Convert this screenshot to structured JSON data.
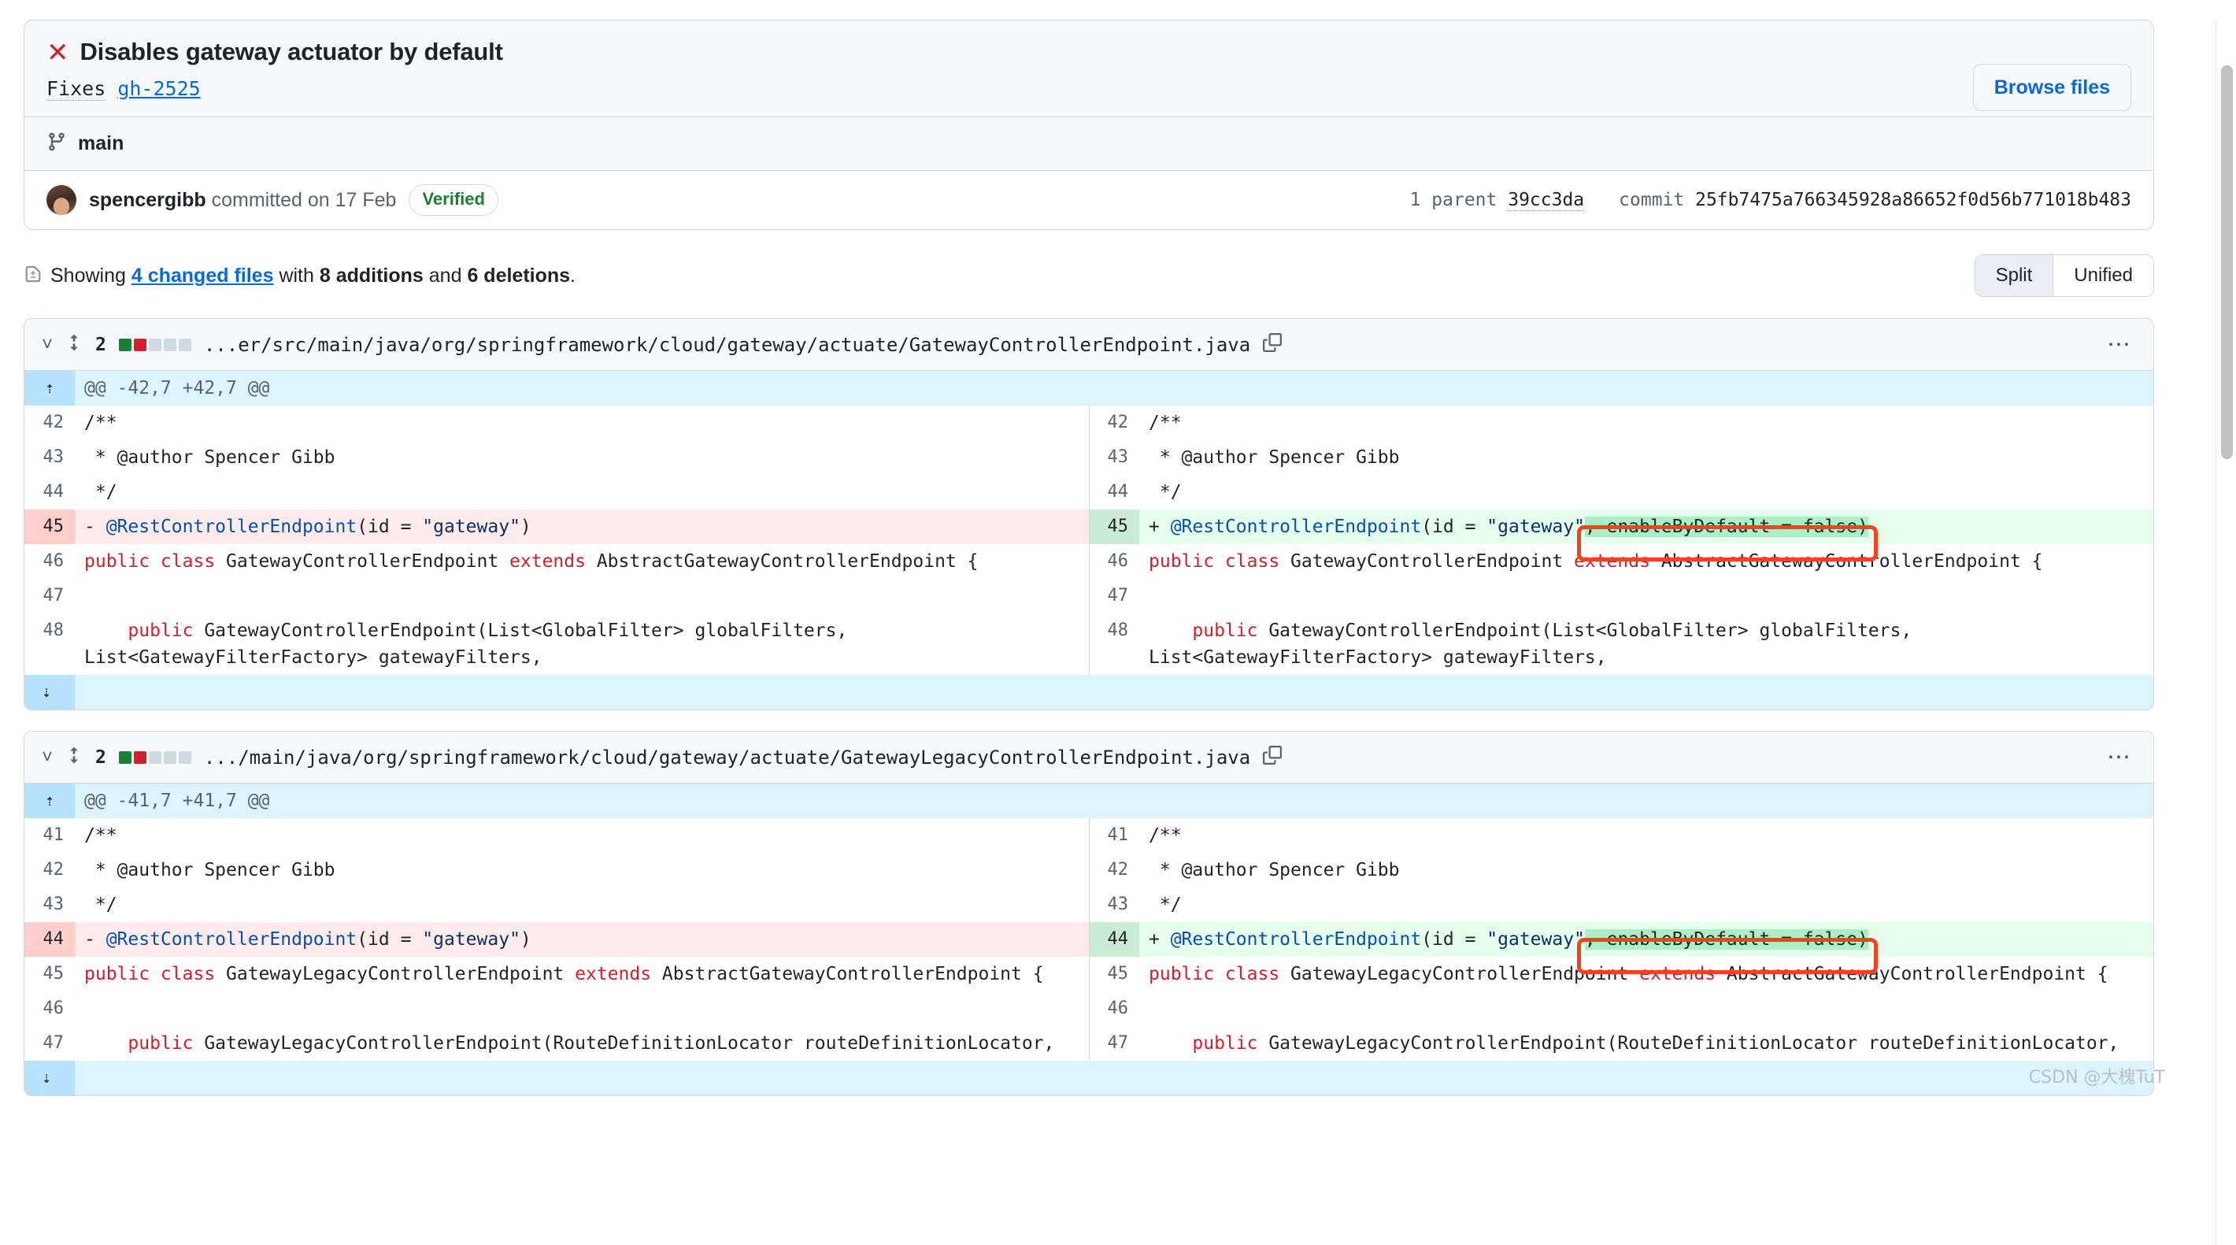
{
  "commit": {
    "status_icon": "x-icon",
    "title": "Disables gateway actuator by default",
    "description_prefix": "Fixes",
    "description_link": "gh-2525",
    "browse_files_label": "Browse files",
    "branch_icon": "git-branch-icon",
    "branch": "main",
    "author": "spencergibb",
    "committed_text": "committed on 17 Feb",
    "verified_badge": "Verified",
    "parent_label": "1 parent",
    "parent_sha": "39cc3da",
    "commit_label": "commit",
    "commit_sha": "25fb7475a766345928a86652f0d56b771018b483"
  },
  "summary": {
    "icon": "file-diff-icon",
    "prefix": "Showing",
    "changed_files": "4 changed files",
    "middle": "with",
    "additions": "8 additions",
    "and": "and",
    "deletions": "6 deletions",
    "suffix": ".",
    "view_modes": [
      {
        "label": "Split",
        "active": true
      },
      {
        "label": "Unified",
        "active": false
      }
    ]
  },
  "files": [
    {
      "collapse_icon": "chevron-down-icon",
      "expand_icon": "unfold-icon",
      "change_count": "2",
      "diffstat": [
        "add",
        "del",
        "none",
        "none",
        "none"
      ],
      "path": "...er/src/main/java/org/springframework/cloud/gateway/actuate/GatewayControllerEndpoint.java",
      "copy_icon": "copy-icon",
      "menu_icon": "kebab-horizontal-icon",
      "hunk_header": "@@ -42,7 +42,7 @@",
      "rows": [
        {
          "type": "context",
          "ln": "42",
          "rn": "42",
          "left": [
            {
              "t": "/**",
              "c": "c"
            }
          ],
          "right": [
            {
              "t": "/**",
              "c": "c"
            }
          ]
        },
        {
          "type": "context",
          "ln": "43",
          "rn": "43",
          "left": [
            {
              "t": " * @author Spencer Gibb",
              "c": "c"
            }
          ],
          "right": [
            {
              "t": " * @author Spencer Gibb",
              "c": "c"
            }
          ]
        },
        {
          "type": "context",
          "ln": "44",
          "rn": "44",
          "left": [
            {
              "t": " */",
              "c": "c"
            }
          ],
          "right": [
            {
              "t": " */",
              "c": "c"
            }
          ]
        },
        {
          "type": "change",
          "ln": "45",
          "rn": "45",
          "left_sign": "-",
          "right_sign": "+",
          "left": [
            {
              "t": "@RestControllerEndpoint",
              "c": "a"
            },
            {
              "t": "(id = ",
              "c": ""
            },
            {
              "t": "\"gateway\"",
              "c": "s"
            },
            {
              "t": ")",
              "c": ""
            }
          ],
          "right": [
            {
              "t": "@RestControllerEndpoint",
              "c": "a"
            },
            {
              "t": "(id = ",
              "c": ""
            },
            {
              "t": "\"gateway\"",
              "c": "s"
            },
            {
              "t": ", enableByDefault = false)",
              "c": "mark-add"
            }
          ]
        },
        {
          "type": "context",
          "ln": "46",
          "rn": "46",
          "left": [
            {
              "t": "public class ",
              "c": "k"
            },
            {
              "t": "GatewayControllerEndpoint ",
              "c": ""
            },
            {
              "t": "extends ",
              "c": "k"
            },
            {
              "t": "AbstractGatewayControllerEndpoint {",
              "c": ""
            }
          ],
          "right": [
            {
              "t": "public class ",
              "c": "k"
            },
            {
              "t": "GatewayControllerEndpoint ",
              "c": ""
            },
            {
              "t": "extends ",
              "c": "k"
            },
            {
              "t": "AbstractGatewayControllerEndpoint {",
              "c": ""
            }
          ]
        },
        {
          "type": "context",
          "ln": "47",
          "rn": "47",
          "left": [
            {
              "t": "",
              "c": ""
            }
          ],
          "right": [
            {
              "t": "",
              "c": ""
            }
          ]
        },
        {
          "type": "context",
          "ln": "48",
          "rn": "48",
          "left": [
            {
              "t": "    public ",
              "c": "k"
            },
            {
              "t": "GatewayControllerEndpoint(List<GlobalFilter> globalFilters, List<GatewayFilterFactory> gatewayFilters,",
              "c": ""
            }
          ],
          "right": [
            {
              "t": "    public ",
              "c": "k"
            },
            {
              "t": "GatewayControllerEndpoint(List<GlobalFilter> globalFilters, List<GatewayFilterFactory> gatewayFilters,",
              "c": ""
            }
          ]
        }
      ],
      "expand_down_icon": "expand-down-icon"
    },
    {
      "collapse_icon": "chevron-down-icon",
      "expand_icon": "unfold-icon",
      "change_count": "2",
      "diffstat": [
        "add",
        "del",
        "none",
        "none",
        "none"
      ],
      "path": ".../main/java/org/springframework/cloud/gateway/actuate/GatewayLegacyControllerEndpoint.java",
      "copy_icon": "copy-icon",
      "menu_icon": "kebab-horizontal-icon",
      "hunk_header": "@@ -41,7 +41,7 @@",
      "rows": [
        {
          "type": "context",
          "ln": "41",
          "rn": "41",
          "left": [
            {
              "t": "/**",
              "c": "c"
            }
          ],
          "right": [
            {
              "t": "/**",
              "c": "c"
            }
          ]
        },
        {
          "type": "context",
          "ln": "42",
          "rn": "42",
          "left": [
            {
              "t": " * @author Spencer Gibb",
              "c": "c"
            }
          ],
          "right": [
            {
              "t": " * @author Spencer Gibb",
              "c": "c"
            }
          ]
        },
        {
          "type": "context",
          "ln": "43",
          "rn": "43",
          "left": [
            {
              "t": " */",
              "c": "c"
            }
          ],
          "right": [
            {
              "t": " */",
              "c": "c"
            }
          ]
        },
        {
          "type": "change",
          "ln": "44",
          "rn": "44",
          "left_sign": "-",
          "right_sign": "+",
          "left": [
            {
              "t": "@RestControllerEndpoint",
              "c": "a"
            },
            {
              "t": "(id = ",
              "c": ""
            },
            {
              "t": "\"gateway\"",
              "c": "s"
            },
            {
              "t": ")",
              "c": ""
            }
          ],
          "right": [
            {
              "t": "@RestControllerEndpoint",
              "c": "a"
            },
            {
              "t": "(id = ",
              "c": ""
            },
            {
              "t": "\"gateway\"",
              "c": "s"
            },
            {
              "t": ", enableByDefault = false)",
              "c": "mark-add"
            }
          ]
        },
        {
          "type": "context",
          "ln": "45",
          "rn": "45",
          "left": [
            {
              "t": "public class ",
              "c": "k"
            },
            {
              "t": "GatewayLegacyControllerEndpoint ",
              "c": ""
            },
            {
              "t": "extends ",
              "c": "k"
            },
            {
              "t": "AbstractGatewayControllerEndpoint {",
              "c": ""
            }
          ],
          "right": [
            {
              "t": "public class ",
              "c": "k"
            },
            {
              "t": "GatewayLegacyControllerEndpoint ",
              "c": ""
            },
            {
              "t": "extends ",
              "c": "k"
            },
            {
              "t": "AbstractGatewayControllerEndpoint {",
              "c": ""
            }
          ]
        },
        {
          "type": "context",
          "ln": "46",
          "rn": "46",
          "left": [
            {
              "t": "",
              "c": ""
            }
          ],
          "right": [
            {
              "t": "",
              "c": ""
            }
          ]
        },
        {
          "type": "context",
          "ln": "47",
          "rn": "47",
          "left": [
            {
              "t": "    public ",
              "c": "k"
            },
            {
              "t": "GatewayLegacyControllerEndpoint(RouteDefinitionLocator routeDefinitionLocator,",
              "c": ""
            }
          ],
          "right": [
            {
              "t": "    public ",
              "c": "k"
            },
            {
              "t": "GatewayLegacyControllerEndpoint(RouteDefinitionLocator routeDefinitionLocator,",
              "c": ""
            }
          ]
        }
      ],
      "expand_down_icon": "expand-down-icon"
    }
  ],
  "watermark": "CSDN @大槐TuT",
  "colors": {
    "link": "#0969da",
    "danger": "#cf222e",
    "success": "#1a7f37",
    "annotation": "#f4411f",
    "add_bg": "#e6ffec",
    "del_bg": "#ffebe9"
  }
}
